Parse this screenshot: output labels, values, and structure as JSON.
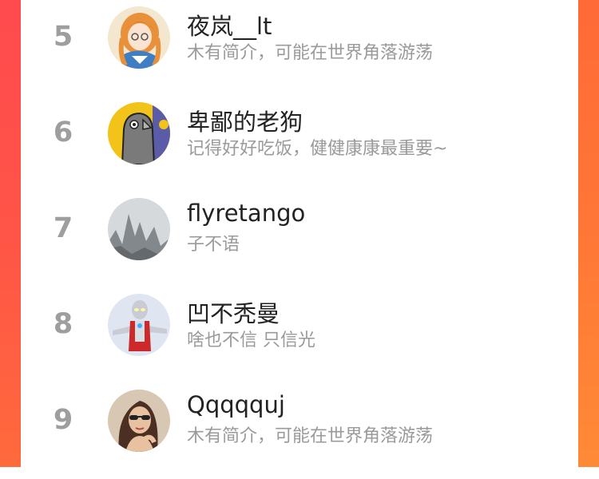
{
  "ranking": {
    "items": [
      {
        "rank": "5",
        "name": "夜岚__lt",
        "bio": "木有简介，可能在世界角落游荡",
        "avatar_icon": "anime-girl-avatar"
      },
      {
        "rank": "6",
        "name": "卑鄙的老狗",
        "bio": "记得好好吃饭，健健康康最重要~",
        "avatar_icon": "pigeon-avatar"
      },
      {
        "rank": "7",
        "name": "flyretango",
        "bio": "子不语",
        "avatar_icon": "misty-mountain-avatar"
      },
      {
        "rank": "8",
        "name": "凹不秃曼",
        "bio": "啥也不信 只信光",
        "avatar_icon": "ultraman-avatar"
      },
      {
        "rank": "9",
        "name": "Qqqqquj",
        "bio": "木有简介，可能在世界角落游荡",
        "avatar_icon": "woman-sunglasses-avatar"
      }
    ]
  },
  "colors": {
    "left_edge": "#ff4a4e",
    "right_edge": "#ff7736",
    "rank_text": "#9e9e9e",
    "name_text": "#222222",
    "bio_text": "#9a9a9a"
  }
}
